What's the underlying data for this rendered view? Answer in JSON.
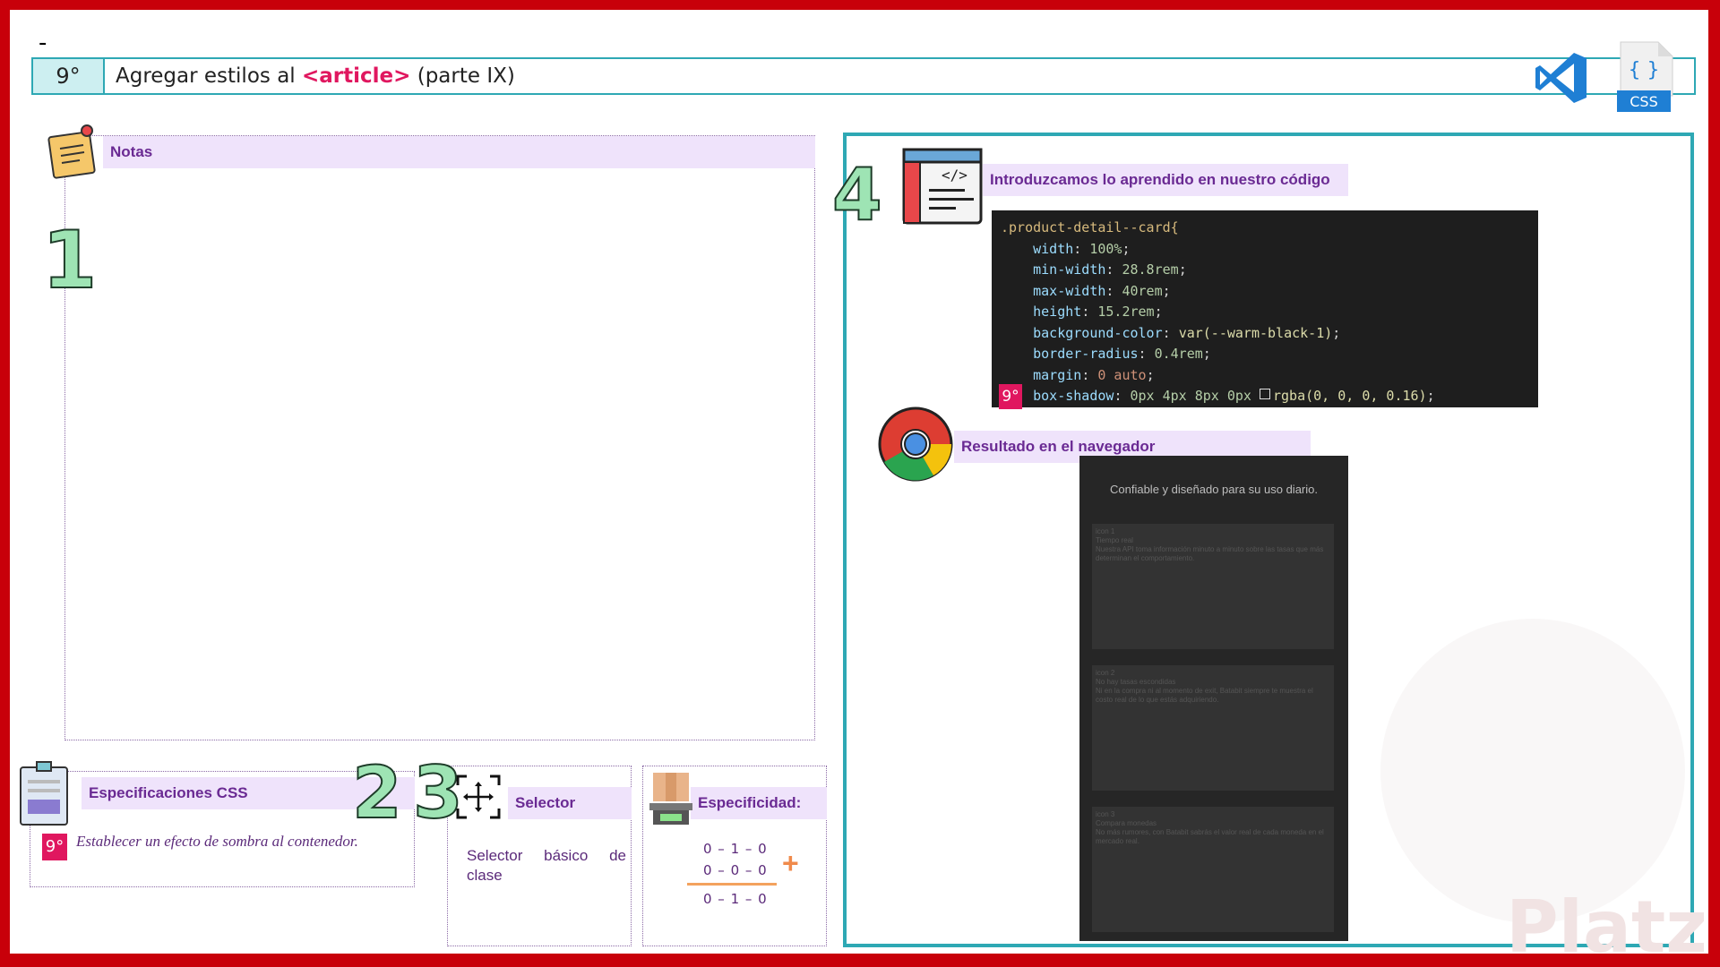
{
  "slide": {
    "dash": "-"
  },
  "header": {
    "number": "9°",
    "title_prefix": "Agregar estilos al ",
    "title_tag": "<article>",
    "title_suffix": " (parte IX)",
    "css_label": "CSS"
  },
  "notes": {
    "label": "Notas",
    "number": "1"
  },
  "specs": {
    "label": "Especificaciones CSS",
    "badge": "9°",
    "text": "Establecer un efecto de sombra al contenedor.",
    "number": "2"
  },
  "selector": {
    "label": "Selector",
    "text": "Selector básico de clase",
    "number": "3"
  },
  "specificity": {
    "label": "Especificidad:",
    "line1": "0 – 1 – 0",
    "line2": "0 – 0 – 0",
    "result": "0 – 1 – 0",
    "plus": "+"
  },
  "code_section": {
    "number": "4",
    "label": "Introduzcamos lo aprendido en nuestro código",
    "badge": "9°",
    "selector": ".product-detail--card{",
    "lines": [
      {
        "prop": "width",
        "value": "100%"
      },
      {
        "prop": "min-width",
        "value": "28.8rem"
      },
      {
        "prop": "max-width",
        "value": "40rem"
      },
      {
        "prop": "height",
        "value": "15.2rem"
      },
      {
        "prop": "background-color",
        "value": "var(--warm-black-1)"
      },
      {
        "prop": "border-radius",
        "value": "0.4rem"
      },
      {
        "prop": "margin",
        "value": "0 auto"
      },
      {
        "prop": "box-shadow",
        "value": "0px 4px 8px 0px",
        "extra": "rgba(0, 0, 0, 0.16)"
      }
    ]
  },
  "result_section": {
    "label": "Resultado en el navegador",
    "heading": "Confiable y diseñado para su uso diario.",
    "cards": [
      {
        "l1": "icon 1",
        "l2": "Tiempo real",
        "l3": "Nuestra API toma información minuto a minuto sobre las tasas que más determinan el comportamiento."
      },
      {
        "l1": "icon 2",
        "l2": "No hay tasas escondidas",
        "l3": "Ni en la compra ni al momento de exit, Batabit siempre te muestra el costo real de lo que estás adquiriendo."
      },
      {
        "l1": "icon 3",
        "l2": "Compara monedas",
        "l3": "No más rumores, con Batabit sabrás el valor real de cada moneda en el mercado real."
      }
    ]
  },
  "watermark": {
    "brand": "Platzi"
  },
  "colors": {
    "frame": "#c8000a",
    "teal": "#2ea8b4",
    "label_bg": "#efe3fb",
    "label_text": "#6a2a93",
    "accent": "#e0175f"
  }
}
